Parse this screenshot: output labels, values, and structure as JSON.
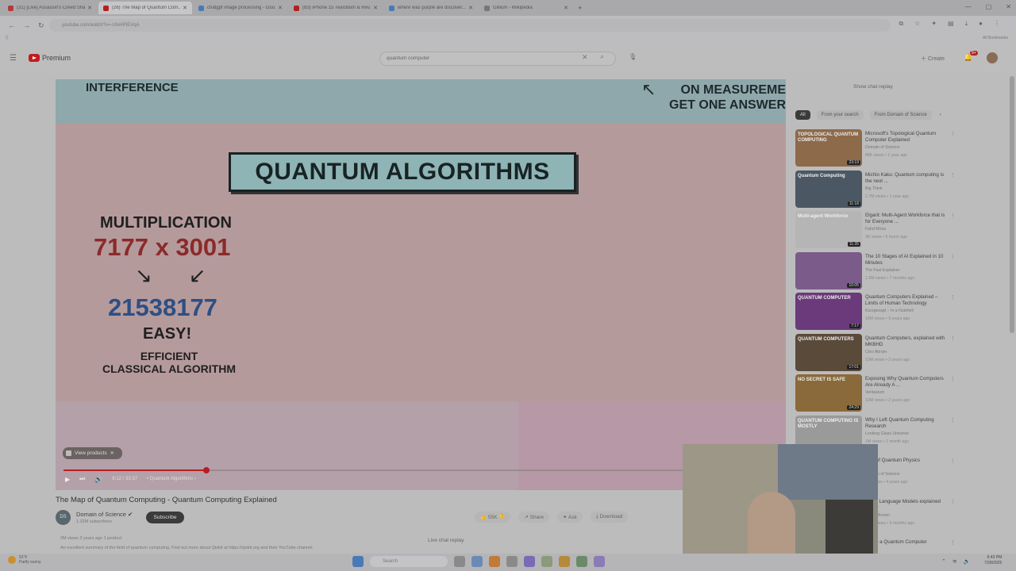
{
  "browser": {
    "tabs": [
      {
        "title": "(31) [Live] Assassin's Creed Sha...",
        "color": "#b43a3a",
        "active": false
      },
      {
        "title": "(26) The Map of Quantum Com...",
        "color": "#b42020",
        "active": true
      },
      {
        "title": "chatgpt image processing - Goo...",
        "color": "#4a7ab5",
        "active": false
      },
      {
        "title": "(83) iPhone 15 Teardown & Rev...",
        "color": "#b42020",
        "active": false
      },
      {
        "title": "where was purple are discover...",
        "color": "#4a7ab5",
        "active": false
      },
      {
        "title": "Gillium - Wikipedia",
        "color": "#777777",
        "active": false
      }
    ],
    "new_tab": "+",
    "url": "youtube.com/watch?v=-UlxHPIEVqA",
    "all_bookmarks": "All Bookmarks"
  },
  "youtube": {
    "logo_text": "Premium",
    "search_value": "quantum computer",
    "create_label": "Create",
    "notif_count": "9+"
  },
  "video": {
    "slide_top_left": "INTERFERENCE",
    "slide_top_right_1": "ON MEASUREME",
    "slide_top_right_2": "GET ONE ANSWER",
    "slide_title": "QUANTUM ALGORITHMS",
    "mult_label": "MULTIPLICATION",
    "mult_expr": "7177 x 3001",
    "result": "21538177",
    "easy": "EASY!",
    "efficient": "EFFICIENT",
    "classical": "CLASSICAL ALGORITHM",
    "view_products": "View products",
    "time": "6:12 / 33:37",
    "chapter": "• Quantum Algorithms ›",
    "progress": 0.2
  },
  "details": {
    "title": "The Map of Quantum Computing - Quantum Computing Explained",
    "channel_initials": "DS",
    "channel": "Domain of Science",
    "subscribers": "1.32M subscribers",
    "subscribe": "Subscribe",
    "likes": "55K",
    "share": "Share",
    "ask": "Ask",
    "download": "Download",
    "views": "2M views  3 years ago  1 product",
    "desc": "An excellent summary of the field of quantum computing. Find out more about Qiskit at https://qiskit.org and their YouTube channel.",
    "live_chat": "Live chat replay"
  },
  "sidebar": {
    "show_chat": "Show chat replay",
    "chips": [
      "All",
      "From your search",
      "From Domain of Science"
    ],
    "chip_next": "›",
    "recs": [
      {
        "title": "Microsoft's Topological Quantum Computer Explained",
        "channel": "Domain of Science",
        "meta": "88K views • 1 year ago",
        "duration": "23:19",
        "thumb_text": "TOPOLOGICAL QUANTUM COMPUTING",
        "bg": "#8d6a4a"
      },
      {
        "title": "Michio Kaku: Quantum computing is the next ...",
        "channel": "Big Think",
        "meta": "2.7M views • 1 year ago",
        "duration": "11:18",
        "thumb_text": "Quantum Computing",
        "bg": "#4b5864"
      },
      {
        "title": "Elgarit: Multi-Agent Workforce that is for Everyone ...",
        "channel": "Fahd Mirza",
        "meta": "3K views • 5 hours ago",
        "duration": "11:35",
        "thumb_text": "Multi-agent Workforce",
        "bg": "#b5b5b5"
      },
      {
        "title": "The 10 Stages of AI Explained in 10 Minutes",
        "channel": "The Fast Explainer",
        "meta": "1.5M views • 7 months ago",
        "duration": "10:05",
        "thumb_text": "",
        "bg": "#7a5b8a"
      },
      {
        "title": "Quantum Computers Explained – Limits of Human Technology",
        "channel": "Kurzgesagt – In a Nutshell",
        "meta": "18M views • 9 years ago",
        "duration": "7:17",
        "thumb_text": "QUANTUM COMPUTER",
        "bg": "#6a3a7a"
      },
      {
        "title": "Quantum Computers, explained with MKBHD",
        "channel": "Cleo Abram",
        "meta": "10M views • 2 years ago",
        "duration": "17:01",
        "thumb_text": "QUANTUM COMPUTERS",
        "bg": "#5a4a3a"
      },
      {
        "title": "Exposing Why Quantum Computers Are Already A ...",
        "channel": "Veritasium",
        "meta": "10M views • 2 years ago",
        "duration": "24:29",
        "thumb_text": "NO SECRET IS SAFE",
        "bg": "#8a6a3a"
      },
      {
        "title": "Why I Left Quantum Computing Research",
        "channel": "Looking Glass Universe",
        "meta": "1M views • 1 month ago",
        "duration": "",
        "thumb_text": "QUANTUM COMPUTING IS MOSTLY",
        "bg": "#9a9a9a"
      },
      {
        "title": "Map of Quantum Physics",
        "channel": "Domain of Science",
        "meta": "6M views • 4 years ago",
        "duration": "",
        "thumb_text": "",
        "bg": "#a0a0a0"
      },
      {
        "title": "Large Language Models explained briefly",
        "channel": "3Blue1Brown",
        "meta": "3.4M views • 9 months ago",
        "duration": "",
        "thumb_text": "",
        "bg": "#a0a0a0"
      },
      {
        "title": "Inside a Quantum Computer",
        "channel": "",
        "meta": "",
        "duration": "",
        "thumb_text": "",
        "bg": "#a0a0a0"
      }
    ]
  },
  "taskbar": {
    "temp": "91°F",
    "weather": "Partly sunny",
    "search": "Search",
    "time": "6:43 PM",
    "date": "7/28/2025"
  }
}
